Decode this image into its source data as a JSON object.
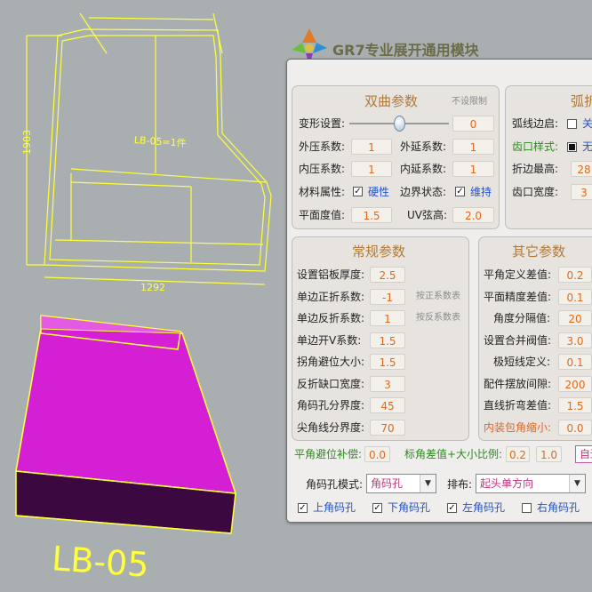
{
  "drawing": {
    "dim_height": "1903",
    "dim_width": "1292",
    "part_note": "LB-05=1件",
    "part_label": "LB-05",
    "colors": {
      "background": "#a9afb1",
      "outline": "#ffff3c",
      "part_top": "#d51fd5",
      "part_side": "#3b0840"
    }
  },
  "app": {
    "title": "GR7专业展开通用模块"
  },
  "double_curve": {
    "title": "双曲参数",
    "no_limit": "不设限制",
    "deform_label": "变形设置:",
    "deform_value": "0",
    "deform_slider_level": 0.5,
    "outer_press_label": "外压系数:",
    "outer_press_value": "1",
    "outer_ext_label": "外延系数:",
    "outer_ext_value": "1",
    "inner_press_label": "内压系数:",
    "inner_press_value": "1",
    "inner_ext_label": "内延系数:",
    "inner_ext_value": "1",
    "material_label": "材料属性:",
    "material_check": "硬性",
    "material_checked": true,
    "boundary_label": "边界状态:",
    "boundary_check": "维持",
    "boundary_checked": true,
    "flatness_label": "平面度值:",
    "flatness_value": "1.5",
    "uv_label": "UV弦高:",
    "uv_value": "2.0"
  },
  "arc": {
    "title": "弧折",
    "arc_edge_label": "弧线边启:",
    "arc_edge_check": "关",
    "arc_edge_checked": false,
    "tooth_label": "齿口样式:",
    "tooth_check": "无",
    "tooth_checked": true,
    "fold_max_label": "折边最高:",
    "fold_max_value": "28",
    "tooth_width_label": "齿口宽度:",
    "tooth_width_value": "3"
  },
  "general": {
    "title": "常规参数",
    "rows": [
      {
        "label": "设置铝板厚度:",
        "value": "2.5",
        "hint": ""
      },
      {
        "label": "单边正折系数:",
        "value": "-1",
        "hint": "按正系数表"
      },
      {
        "label": "单边反折系数:",
        "value": "1",
        "hint": "按反系数表"
      },
      {
        "label": "单边开V系数:",
        "value": "1.5",
        "hint": ""
      },
      {
        "label": "拐角避位大小:",
        "value": "1.5",
        "hint": ""
      },
      {
        "label": "反折缺口宽度:",
        "value": "3",
        "hint": ""
      },
      {
        "label": "角码孔分界度:",
        "value": "45",
        "hint": ""
      },
      {
        "label": "尖角线分界度:",
        "value": "70",
        "hint": ""
      }
    ]
  },
  "other": {
    "title": "其它参数",
    "rows": [
      {
        "label": "平角定义差值:",
        "value": "0.2"
      },
      {
        "label": "平面精度差值:",
        "value": "0.1"
      },
      {
        "label": "角度分隔值:",
        "value": "20"
      },
      {
        "label": "设置合并阀值:",
        "value": "3.0"
      },
      {
        "label": "极短线定义:",
        "value": "0.1"
      },
      {
        "label": "配件摆放间隙:",
        "value": "200"
      },
      {
        "label": "直线折弯差值:",
        "value": "1.5"
      },
      {
        "label": "内装包角缩小:",
        "value": "0.0"
      }
    ]
  },
  "bottom": {
    "flat_comp_label": "平角避位补偿:",
    "flat_comp_value": "0.0",
    "scale_label": "标角差值+大小比例:",
    "scale_value1": "0.2",
    "scale_value2": "1.0",
    "auto_label": "自适",
    "hole_mode_label": "角码孔模式:",
    "hole_mode_value": "角码孔",
    "layout_label": "排布:",
    "layout_value": "起头单方向",
    "checks": [
      {
        "label": "上角码孔",
        "checked": true
      },
      {
        "label": "下角码孔",
        "checked": true
      },
      {
        "label": "左角码孔",
        "checked": true
      },
      {
        "label": "右角码孔",
        "checked": false
      }
    ]
  }
}
